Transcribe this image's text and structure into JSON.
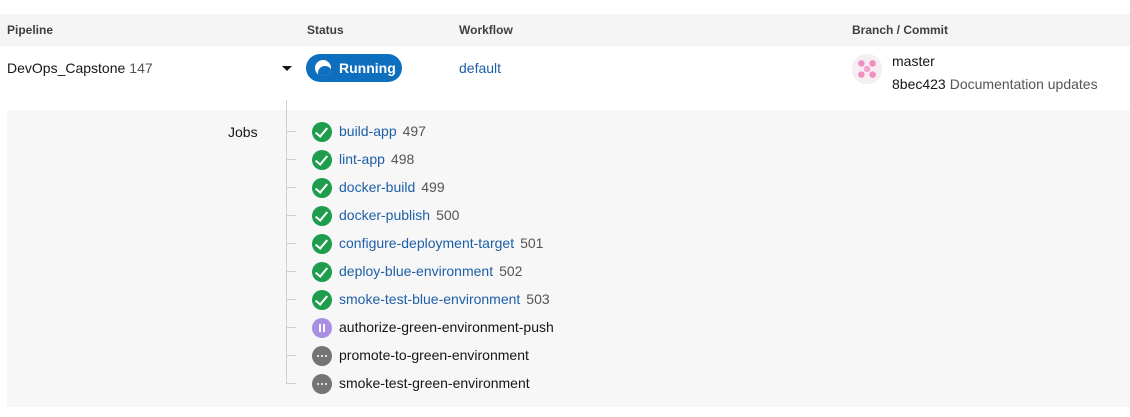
{
  "header": {
    "pipeline": "Pipeline",
    "status": "Status",
    "workflow": "Workflow",
    "branch_commit": "Branch / Commit"
  },
  "pipeline": {
    "name": "DevOps_Capstone",
    "number": "147",
    "status": "Running",
    "workflow": "default",
    "branch": "master",
    "commit_sha": "8bec423",
    "commit_message": "Documentation updates"
  },
  "jobs_label": "Jobs",
  "jobs": [
    {
      "name": "build-app",
      "number": "497",
      "status": "success"
    },
    {
      "name": "lint-app",
      "number": "498",
      "status": "success"
    },
    {
      "name": "docker-build",
      "number": "499",
      "status": "success"
    },
    {
      "name": "docker-publish",
      "number": "500",
      "status": "success"
    },
    {
      "name": "configure-deployment-target",
      "number": "501",
      "status": "success"
    },
    {
      "name": "deploy-blue-environment",
      "number": "502",
      "status": "success"
    },
    {
      "name": "smoke-test-blue-environment",
      "number": "503",
      "status": "success"
    },
    {
      "name": "authorize-green-environment-push",
      "number": "",
      "status": "on-hold"
    },
    {
      "name": "promote-to-green-environment",
      "number": "",
      "status": "blocked"
    },
    {
      "name": "smoke-test-green-environment",
      "number": "",
      "status": "blocked"
    }
  ],
  "colors": {
    "running": "#0e6fbf",
    "success": "#1f9d4e",
    "on_hold": "#a98ee6",
    "blocked": "#747474",
    "link": "#1d5fa7"
  }
}
